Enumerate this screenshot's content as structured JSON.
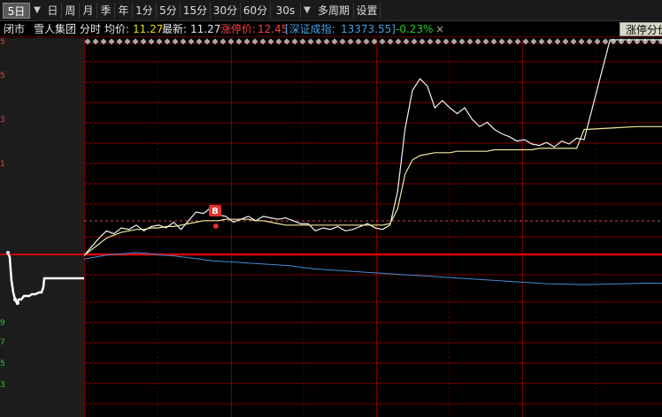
{
  "toolbar": {
    "items": [
      "5日",
      "日",
      "周",
      "月",
      "季",
      "年",
      "1分",
      "5分",
      "15分",
      "30分",
      "60分",
      "30s",
      "多周期",
      "设置"
    ],
    "selected": "5日"
  },
  "info": {
    "status": "闭市",
    "stock_name": "雪人集团",
    "mode": "分时",
    "avg_label": "均价:",
    "avg_value": "11.27",
    "latest_label": "最新:",
    "latest_value": "11.27",
    "limit_label": "涨停价:",
    "limit_value": "12.45",
    "index_label": "[深证成指:",
    "index_value": "13373.55]",
    "index_change": "-0.23%",
    "close_symbol": "×",
    "limit_button": "涨停分价"
  },
  "left_ticks": [
    "5",
    "5",
    "3",
    "1",
    "9",
    "7",
    "5",
    "3"
  ],
  "chart_data": {
    "type": "line",
    "markers": [
      {
        "label": "B"
      }
    ],
    "series": [
      {
        "values": [
          10.96,
          11.02,
          11.08,
          11.13,
          11.11,
          11.15,
          11.14,
          11.17,
          11.13,
          11.16,
          11.17,
          11.15,
          11.19,
          11.14,
          11.2,
          11.26,
          11.25,
          11.29,
          11.24,
          11.23,
          11.19,
          11.21,
          11.23,
          11.2,
          11.23,
          11.22,
          11.21,
          11.22,
          11.2,
          11.18,
          11.18,
          11.13,
          11.15,
          11.14,
          11.16,
          11.13,
          11.14,
          11.16,
          11.18,
          11.15,
          11.14,
          11.17,
          11.4,
          11.83,
          12.1,
          12.18,
          12.13,
          11.98,
          12.03,
          11.98,
          11.94,
          11.98,
          11.9,
          11.85,
          11.88,
          11.83,
          11.8,
          11.78,
          11.75,
          11.76,
          11.73,
          11.72,
          11.74,
          11.71,
          11.75,
          11.73,
          11.77,
          11.76,
          12.45,
          12.45,
          12.45
        ]
      },
      {
        "values": [
          10.96,
          11.0,
          11.04,
          11.08,
          11.1,
          11.12,
          11.13,
          11.14,
          11.14,
          11.15,
          11.15,
          11.16,
          11.16,
          11.17,
          11.18,
          11.19,
          11.2,
          11.2,
          11.2,
          11.21,
          11.21,
          11.21,
          11.21,
          11.2,
          11.2,
          11.19,
          11.18,
          11.17,
          11.17,
          11.17,
          11.17,
          11.17,
          11.17,
          11.17,
          11.17,
          11.17,
          11.17,
          11.17,
          11.17,
          11.17,
          11.17,
          11.18,
          11.28,
          11.52,
          11.62,
          11.65,
          11.66,
          11.67,
          11.67,
          11.67,
          11.68,
          11.68,
          11.68,
          11.68,
          11.68,
          11.69,
          11.69,
          11.69,
          11.69,
          11.69,
          11.69,
          11.7,
          11.7,
          11.7,
          11.7,
          11.7,
          11.7,
          11.83,
          11.84,
          11.85,
          11.85
        ]
      },
      {
        "values": [
          13520,
          13535,
          13548,
          13552,
          13560,
          13555,
          13545,
          13540,
          13530,
          13520,
          13510,
          13505,
          13500,
          13495,
          13490,
          13485,
          13480,
          13470,
          13460,
          13455,
          13450,
          13445,
          13440,
          13435,
          13430,
          13425,
          13420,
          13415,
          13410,
          13405,
          13400,
          13395,
          13390,
          13385,
          13380,
          13375,
          13370,
          13368,
          13366,
          13365,
          13366,
          13368,
          13370,
          13372,
          13374,
          13373
        ]
      }
    ]
  }
}
